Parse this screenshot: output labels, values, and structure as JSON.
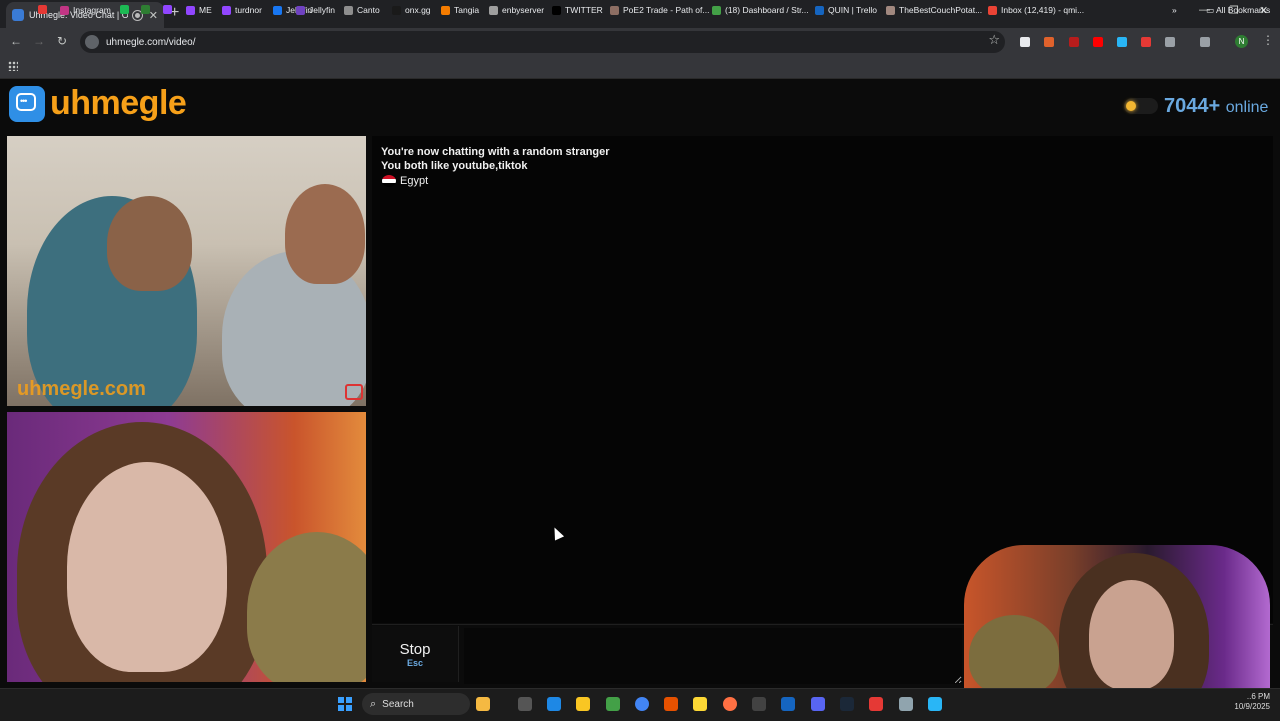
{
  "browser": {
    "tab_title": "Uhmegle: Video Chat | Om...",
    "url": "uhmegle.com/video/",
    "profile_initial": "N",
    "bookmarks": [
      {
        "label": "",
        "color": "#e53935"
      },
      {
        "label": "Instagram",
        "color": "#c13584"
      },
      {
        "label": "",
        "color": "#1db954"
      },
      {
        "label": "",
        "color": "#2e7d32"
      },
      {
        "label": "",
        "color": "#9146ff"
      },
      {
        "label": "ME",
        "color": "#9146ff"
      },
      {
        "label": "turdnor",
        "color": "#9146ff"
      },
      {
        "label": "Jellyfin",
        "color": "#1877f2"
      },
      {
        "label": "Jellyfin",
        "color": "#6f42c1"
      },
      {
        "label": "Canto",
        "color": "#8e8e8e"
      },
      {
        "label": "onx.gg",
        "color": "#1a1a1a"
      },
      {
        "label": "Tangia",
        "color": "#f57c00"
      },
      {
        "label": "enbyserver",
        "color": "#9e9e9e"
      },
      {
        "label": "TWITTER",
        "color": "#000000"
      },
      {
        "label": "PoE2 Trade - Path of...",
        "color": "#8d6e63"
      },
      {
        "label": "(18) Dashboard / Str...",
        "color": "#43a047"
      },
      {
        "label": "QUIN | Trello",
        "color": "#1565c0"
      },
      {
        "label": "TheBestCouchPotat...",
        "color": "#a1887f"
      },
      {
        "label": "Inbox (12,419) - qmi...",
        "color": "#ea4335"
      }
    ],
    "all_bookmarks_label": "All Bookmarks"
  },
  "site": {
    "logo_text": "uhmegle",
    "online_count": "7044+",
    "online_label": "online"
  },
  "chat": {
    "status_line": "You're now chatting with a random stranger",
    "interests_line": "You both like youtube,tiktok",
    "country": "Egypt",
    "stop_label": "Stop",
    "stop_key": "Esc",
    "message_value": "",
    "watermark": "uhmegle.com"
  },
  "taskbar": {
    "search_label": "Search",
    "time": "..6 PM",
    "date": "10/9/2025"
  },
  "colors": {
    "brand_orange": "#f6a019",
    "accent_blue": "#6aa9e0",
    "background": "#0b0b0b"
  }
}
